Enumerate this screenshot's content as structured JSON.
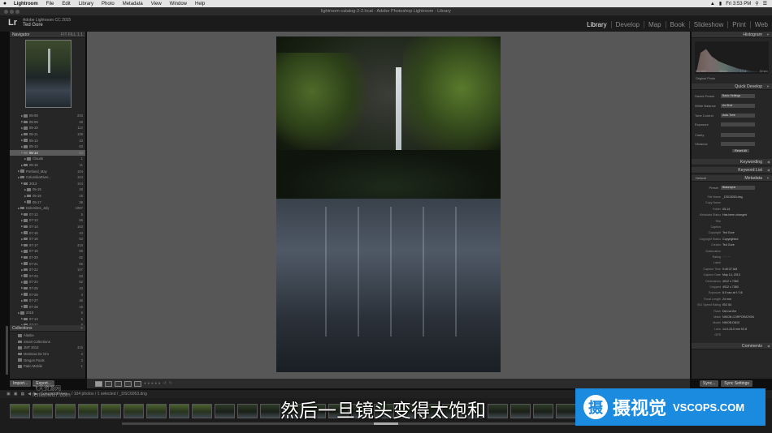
{
  "menubar": {
    "app": "Lightroom",
    "items": [
      "File",
      "Edit",
      "Library",
      "Photo",
      "Metadata",
      "View",
      "Window",
      "Help"
    ],
    "clock": "Fri 3:53 PM"
  },
  "window": {
    "title": "lightroom-catalog-2-2.lrcat - Adobe Photoshop Lightroom - Library"
  },
  "identity": {
    "logo": "Lr",
    "product": "Adobe Lightroom CC 2015",
    "user": "Ted Gore"
  },
  "modules": [
    "Library",
    "Develop",
    "Map",
    "Book",
    "Slideshow",
    "Print",
    "Web"
  ],
  "left_panel": {
    "navigator": {
      "label": "Navigator",
      "options": "FIT  FILL  1:1"
    },
    "folders": [
      {
        "name": "05-08",
        "count": "203",
        "indent": 2
      },
      {
        "name": "05-09",
        "count": "48",
        "indent": 2
      },
      {
        "name": "05-10",
        "count": "112",
        "indent": 2
      },
      {
        "name": "05-11",
        "count": "109",
        "indent": 2
      },
      {
        "name": "05-12",
        "count": "43",
        "indent": 2
      },
      {
        "name": "05-13",
        "count": "63",
        "indent": 2
      },
      {
        "name": "05-14",
        "count": "84",
        "indent": 2,
        "selected": true
      },
      {
        "name": "Clouds",
        "count": "1",
        "indent": 3
      },
      {
        "name": "05-15",
        "count": "11",
        "indent": 2
      },
      {
        "name": "Portland_May",
        "count": "104",
        "indent": 1
      },
      {
        "name": "ColumbiaRiver...",
        "count": "104",
        "indent": 1
      },
      {
        "name": "2013",
        "count": "104",
        "indent": 2
      },
      {
        "name": "05-15",
        "count": "48",
        "indent": 3
      },
      {
        "name": "05-16",
        "count": "18",
        "indent": 3
      },
      {
        "name": "05-17",
        "count": "38",
        "indent": 3
      },
      {
        "name": "Dolomites_July",
        "count": "1967",
        "indent": 1
      },
      {
        "name": "07-12",
        "count": "5",
        "indent": 2
      },
      {
        "name": "07-13",
        "count": "56",
        "indent": 2
      },
      {
        "name": "07-14",
        "count": "163",
        "indent": 2
      },
      {
        "name": "07-15",
        "count": "43",
        "indent": 2
      },
      {
        "name": "07-16",
        "count": "53",
        "indent": 2
      },
      {
        "name": "07-17",
        "count": "319",
        "indent": 2
      },
      {
        "name": "07-18",
        "count": "58",
        "indent": 2
      },
      {
        "name": "07-20",
        "count": "82",
        "indent": 2
      },
      {
        "name": "07-21",
        "count": "68",
        "indent": 2
      },
      {
        "name": "07-22",
        "count": "107",
        "indent": 2
      },
      {
        "name": "07-23",
        "count": "63",
        "indent": 2
      },
      {
        "name": "07-24",
        "count": "62",
        "indent": 2
      },
      {
        "name": "07-25",
        "count": "43",
        "indent": 2
      },
      {
        "name": "07-26",
        "count": "4",
        "indent": 2
      },
      {
        "name": "07-27",
        "count": "46",
        "indent": 2
      },
      {
        "name": "07-28",
        "count": "19",
        "indent": 2
      },
      {
        "name": "2015",
        "count": "5",
        "indent": 1
      },
      {
        "name": "07-13",
        "count": "5",
        "indent": 2
      },
      {
        "name": "07-22",
        "count": "8",
        "indent": 2
      }
    ],
    "collections_label": "Collections",
    "collections": [
      {
        "name": "Alaska",
        "count": ""
      },
      {
        "name": "Smart Collections",
        "count": ""
      },
      {
        "name": "JMT 2012",
        "count": "315"
      },
      {
        "name": "Montana De Oro",
        "count": "2"
      },
      {
        "name": "Oregon Pools",
        "count": "3"
      },
      {
        "name": "Patio Mobile",
        "count": "1"
      }
    ],
    "buttons": {
      "import": "Import...",
      "export": "Export..."
    }
  },
  "right_panel": {
    "histogram": {
      "label": "Histogram",
      "readout": [
        "ISO 800",
        "35mm",
        "f / 16",
        "30 sec"
      ],
      "original_photo": "Original Photo"
    },
    "quick_develop": {
      "label": "Quick Develop",
      "saved_preset_label": "Saved Preset",
      "saved_preset": "Basic Settings",
      "white_balance_label": "White Balance",
      "white_balance": "As Shot",
      "tone_control_label": "Tone Control",
      "tone_control": "Auto Tone",
      "rows": [
        "Exposure",
        "Clarity",
        "Vibrance"
      ],
      "reset": "Reset All"
    },
    "keywording": "Keywording",
    "keyword_list": "Keyword List",
    "metadata_label": "Metadata",
    "metadata_default": "Default",
    "preset_label": "Preset",
    "preset": "Blakedyne",
    "metadata": [
      {
        "k": "File Name",
        "v": "_DSC6053.dng"
      },
      {
        "k": "Copy Name",
        "v": ""
      },
      {
        "k": "Folder",
        "v": "05-14"
      },
      {
        "k": "Metadata Status",
        "v": "Has been changed"
      },
      {
        "k": "Title",
        "v": ""
      },
      {
        "k": "Caption",
        "v": ""
      },
      {
        "k": "Copyright",
        "v": "Ted Gore"
      },
      {
        "k": "Copyright Status",
        "v": "Copyrighted"
      },
      {
        "k": "Creator",
        "v": "Ted Gore"
      },
      {
        "k": "Sublocation",
        "v": ""
      },
      {
        "k": "Rating",
        "v": "· · · · ·"
      },
      {
        "k": "Label",
        "v": ""
      },
      {
        "k": "Capture Time",
        "v": "9:40:37 AM"
      },
      {
        "k": "Capture Date",
        "v": "May 14, 2013"
      },
      {
        "k": "Dimensions",
        "v": "4912 x 7360"
      },
      {
        "k": "Cropped",
        "v": "4912 x 7360"
      },
      {
        "k": "Exposure",
        "v": "8.0 sec at f / 16"
      },
      {
        "k": "Focal Length",
        "v": "24 mm"
      },
      {
        "k": "ISO Speed Rating",
        "v": "ISO 64"
      },
      {
        "k": "Flash",
        "v": "Did not fire"
      },
      {
        "k": "Make",
        "v": "NIKON CORPORATION"
      },
      {
        "k": "Model",
        "v": "NIKON D810"
      },
      {
        "k": "Lens",
        "v": "14.0-24.0 mm f/2.8"
      },
      {
        "k": "GPS",
        "v": ""
      }
    ],
    "comments": "Comments",
    "buttons": {
      "sync": "Sync...",
      "sync_settings": "Sync Settings"
    }
  },
  "filmstrip": {
    "source": "ColumbiaRiver... / 104 photos / 1 selected / _DSC6053.dng",
    "filter": "Filter :"
  },
  "overlay": {
    "subtitle": "然后一旦镜头变得太饱和",
    "watermark_cn": "飞天资源网",
    "watermark_en": "feitianwu7.com",
    "brand_mark": "摄",
    "brand_cn": "摄视觉",
    "brand_en": "VSCOPS.COM"
  },
  "colors": {
    "brand_blue": "#1b8be0",
    "panel": "#262626",
    "canvas": "#575757"
  }
}
